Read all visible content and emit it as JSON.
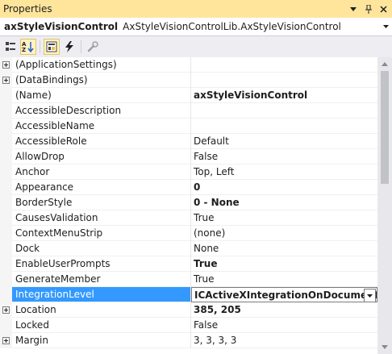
{
  "titlebar": {
    "title": "Properties",
    "dropdown_icon": "chevron-down-icon",
    "pin_icon": "pin-icon",
    "close_icon": "close-icon"
  },
  "object_selector": {
    "name": "axStyleVisionControl",
    "type": "AxStyleVisionControlLib.AxStyleVisionControl"
  },
  "toolbar": {
    "buttons": [
      {
        "icon": "categorized-icon",
        "active": false
      },
      {
        "icon": "alphabetical-sort-icon",
        "active": true
      },
      {
        "icon": "properties-icon",
        "active": true
      },
      {
        "icon": "events-lightning-icon",
        "active": false
      },
      {
        "icon": "property-pages-wrench-icon",
        "active": false
      }
    ]
  },
  "colors": {
    "title_bg": "#ffe59c",
    "selection": "#3399ff",
    "toolbar_bg": "#eeeef2"
  },
  "properties": [
    {
      "name": "(ApplicationSettings)",
      "value": "",
      "expandable": true,
      "bold": false
    },
    {
      "name": "(DataBindings)",
      "value": "",
      "expandable": true,
      "bold": false
    },
    {
      "name": "(Name)",
      "value": "axStyleVisionControl",
      "expandable": false,
      "bold": true
    },
    {
      "name": "AccessibleDescription",
      "value": "",
      "expandable": false,
      "bold": false
    },
    {
      "name": "AccessibleName",
      "value": "",
      "expandable": false,
      "bold": false
    },
    {
      "name": "AccessibleRole",
      "value": "Default",
      "expandable": false,
      "bold": false
    },
    {
      "name": "AllowDrop",
      "value": "False",
      "expandable": false,
      "bold": false
    },
    {
      "name": "Anchor",
      "value": "Top, Left",
      "expandable": false,
      "bold": false
    },
    {
      "name": "Appearance",
      "value": "0",
      "expandable": false,
      "bold": true
    },
    {
      "name": "BorderStyle",
      "value": "0 - None",
      "expandable": false,
      "bold": true
    },
    {
      "name": "CausesValidation",
      "value": "True",
      "expandable": false,
      "bold": false
    },
    {
      "name": "ContextMenuStrip",
      "value": "(none)",
      "expandable": false,
      "bold": false
    },
    {
      "name": "Dock",
      "value": "None",
      "expandable": false,
      "bold": false
    },
    {
      "name": "EnableUserPrompts",
      "value": "True",
      "expandable": false,
      "bold": true
    },
    {
      "name": "GenerateMember",
      "value": "True",
      "expandable": false,
      "bold": false
    },
    {
      "name": "IntegrationLevel",
      "value": "ICActiveXIntegrationOnDocumentLevel",
      "expandable": false,
      "bold": true,
      "selected": true
    },
    {
      "name": "Location",
      "value": "385, 205",
      "expandable": true,
      "bold": true
    },
    {
      "name": "Locked",
      "value": "False",
      "expandable": false,
      "bold": false
    },
    {
      "name": "Margin",
      "value": "3, 3, 3, 3",
      "expandable": true,
      "bold": false
    }
  ]
}
